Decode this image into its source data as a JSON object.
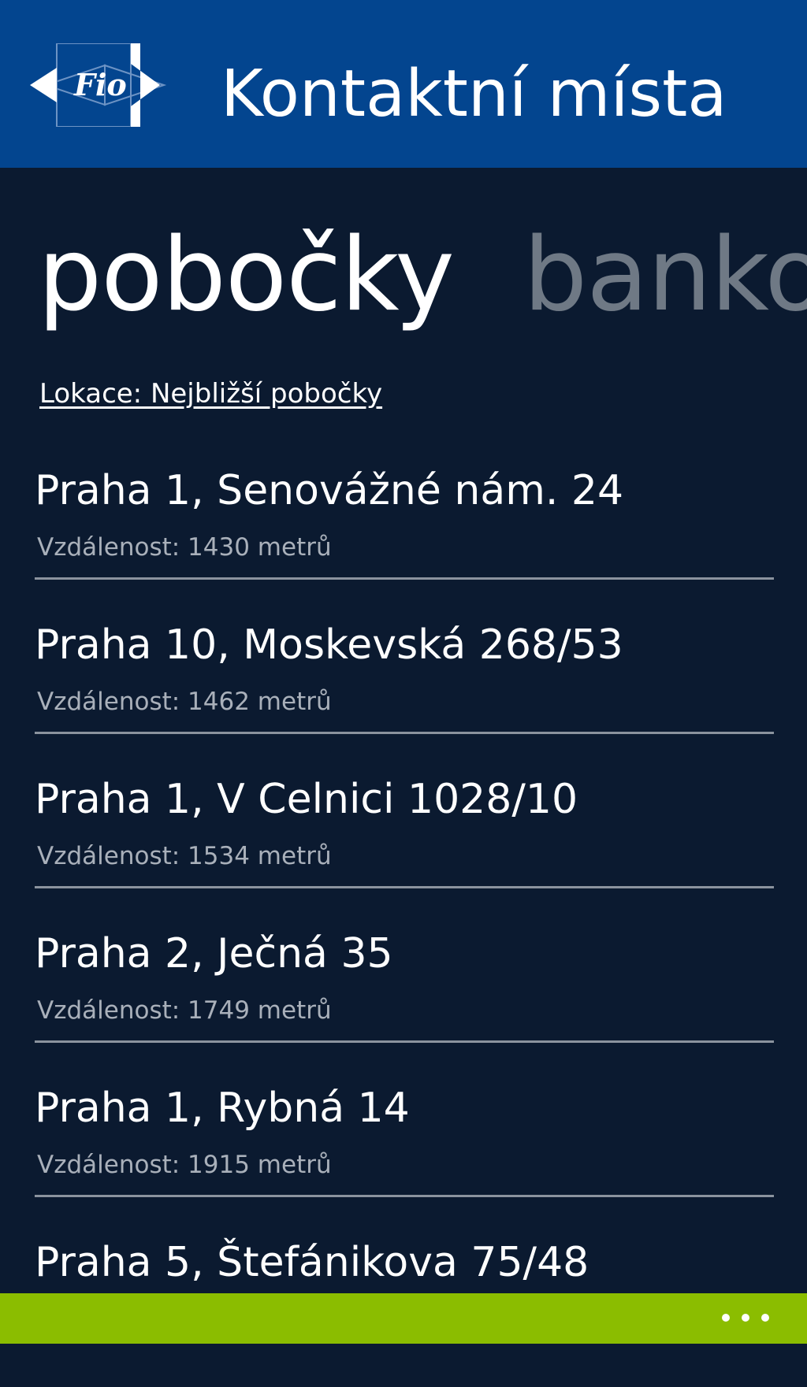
{
  "header": {
    "logo_text": "Fio",
    "title": "Kontaktní místa"
  },
  "pivot": {
    "active_tab": "pobočky",
    "next_tab": "banko"
  },
  "location": {
    "link_text": "Lokace: Nejbližší pobočky"
  },
  "branches": [
    {
      "name": "Praha 1, Senovážné nám. 24",
      "distance": "Vzdálenost: 1430 metrů"
    },
    {
      "name": "Praha 10, Moskevská 268/53",
      "distance": "Vzdálenost: 1462 metrů"
    },
    {
      "name": "Praha 1, V Celnici 1028/10",
      "distance": "Vzdálenost: 1534 metrů"
    },
    {
      "name": "Praha 2, Ječná 35",
      "distance": "Vzdálenost: 1749 metrů"
    },
    {
      "name": "Praha 1, Rybná 14",
      "distance": "Vzdálenost: 1915 metrů"
    },
    {
      "name": "Praha 5, Štefánikova 75/48",
      "distance": ""
    }
  ],
  "app_bar": {
    "more_icon": "ellipsis-icon"
  },
  "colors": {
    "header": "#03458f",
    "background": "#0b1a30",
    "app_bar": "#8bbd00",
    "inactive_tab": "#6f7985",
    "secondary_text": "#a9b0ba"
  }
}
